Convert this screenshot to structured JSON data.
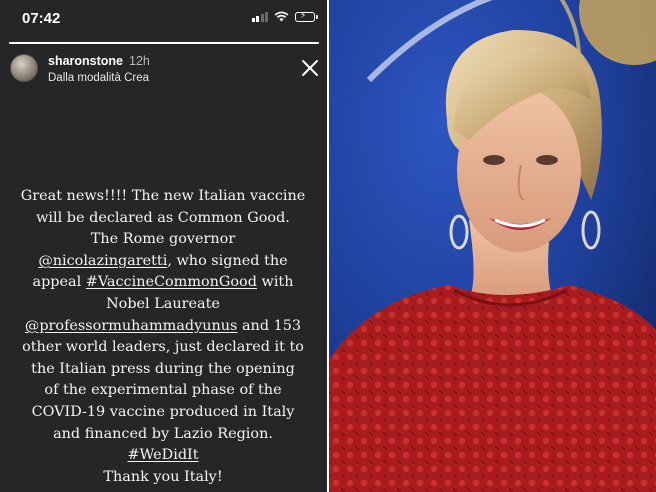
{
  "status_bar": {
    "time": "07:42"
  },
  "story": {
    "progress_fraction": 1.0,
    "username": "sharonstone",
    "posted_ago": "12h",
    "subtitle": "Dalla modalità Crea",
    "close_icon": "close-icon",
    "caption_lines": [
      "Great news!!!! The new Italian vaccine",
      "will be declared as Common Good.",
      "The Rome governor",
      "@nicolazingaretti",
      ", who signed the",
      "appeal",
      "#VaccineCommonGood",
      "with",
      "Nobel Laureate",
      "@professormuhammadyunus",
      "and 153",
      "other world leaders, just declared it to",
      "the Italian press during the opening",
      "of the experimental phase of the",
      "COVID-19 vaccine produced in Italy",
      "and financed by Lazio Region.",
      "#WeDidIt",
      "Thank you Italy!"
    ]
  },
  "photo": {
    "description_icon": "portrait-photo"
  },
  "colors": {
    "story_background": "#262628",
    "photo_background": "#1e3f9a",
    "dress": "#b01f1f"
  }
}
